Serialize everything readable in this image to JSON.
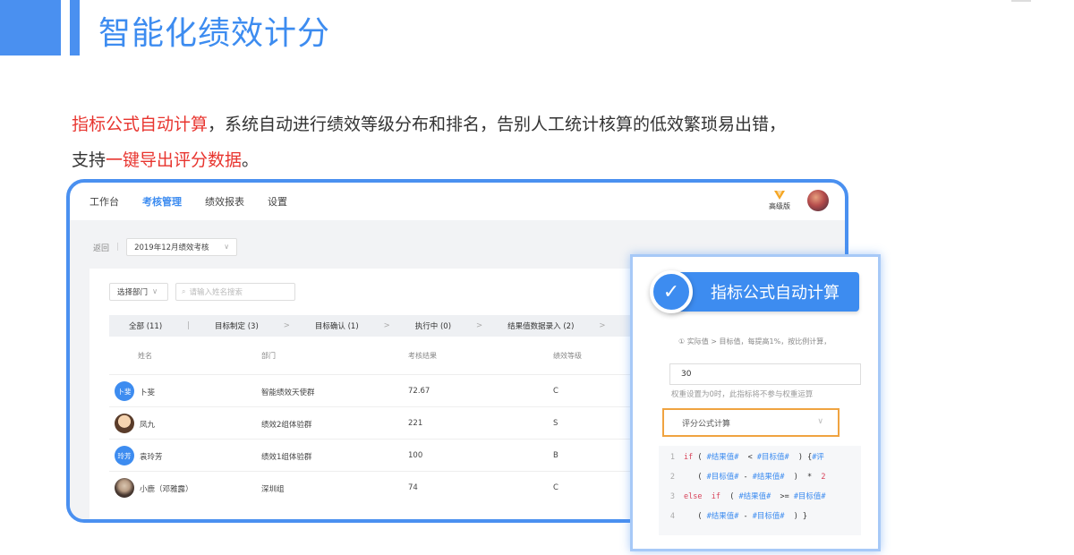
{
  "slide": {
    "title": "智能化绩效计分",
    "desc_line1_highlight": "指标公式自动计算",
    "desc_line1_rest": "，系统自动进行绩效等级分布和排名，告别人工统计核算的低效繁琐易出错，",
    "desc_line2_prefix": "支持",
    "desc_line2_highlight": "一键导出评分数据",
    "desc_line2_suffix": "。"
  },
  "nav": {
    "items": [
      "工作台",
      "考核管理",
      "绩效报表",
      "设置"
    ],
    "vip_label": "高级版"
  },
  "toolbar": {
    "back_label": "返回",
    "separator": "|",
    "period": "2019年12月绩效考核"
  },
  "filters": {
    "dept_label": "选择部门",
    "search_placeholder": "请输入姓名搜索"
  },
  "tabs": [
    "全部 (11)",
    "目标制定 (3)",
    "目标确认 (1)",
    "执行中 (0)",
    "结果值数据录入 (2)"
  ],
  "tab_separators": [
    "|",
    ">",
    ">",
    ">",
    ">"
  ],
  "table": {
    "headers": [
      "姓名",
      "部门",
      "考核结果",
      "绩效等级"
    ],
    "rows": [
      {
        "avatar_text": "卜斐",
        "name": "卜斐",
        "dept": "智能绩效天使群",
        "score": "72.67",
        "grade": "C"
      },
      {
        "avatar_text": "",
        "name": "凤九",
        "dept": "绩效2组体验群",
        "score": "221",
        "grade": "S"
      },
      {
        "avatar_text": "玲芳",
        "name": "袁玲芳",
        "dept": "绩效1组体验群",
        "score": "100",
        "grade": "B"
      },
      {
        "avatar_text": "",
        "name": "小鹿（邓雅露）",
        "dept": "深圳组",
        "score": "74",
        "grade": "C"
      }
    ]
  },
  "popup": {
    "banner": "指标公式自动计算",
    "clipped_text": "① 实际值 > 目标值，每提高1%，按比例计算，",
    "weight_value": "30",
    "hint": "权重设置为0时，此指标将不参与权重运算",
    "formula_select": "评分公式计算",
    "code_lines": [
      {
        "num": "1",
        "tokens": [
          [
            "kw",
            "if"
          ],
          [
            "op",
            " ( "
          ],
          [
            "var",
            "#结果值#"
          ],
          [
            "op",
            "  < "
          ],
          [
            "var",
            "#目标值#"
          ],
          [
            "op",
            "  ) {"
          ],
          [
            "var",
            "#评"
          ]
        ]
      },
      {
        "num": "2",
        "tokens": [
          [
            "op",
            "   ( "
          ],
          [
            "var",
            "#目标值#"
          ],
          [
            "op",
            " - "
          ],
          [
            "var",
            "#结果值#"
          ],
          [
            "op",
            "  )  *  "
          ],
          [
            "num",
            "2"
          ]
        ]
      },
      {
        "num": "3",
        "tokens": [
          [
            "kw",
            "else"
          ],
          [
            "op",
            "  "
          ],
          [
            "kw",
            "if"
          ],
          [
            "op",
            "  ( "
          ],
          [
            "var",
            "#结果值#"
          ],
          [
            "op",
            "  >= "
          ],
          [
            "var",
            "#目标值#"
          ]
        ]
      },
      {
        "num": "4",
        "tokens": [
          [
            "op",
            "   ( "
          ],
          [
            "var",
            "#结果值#"
          ],
          [
            "op",
            " - "
          ],
          [
            "var",
            "#目标值#"
          ],
          [
            "op",
            "  ) }"
          ]
        ]
      }
    ]
  },
  "colors": {
    "accent": "#3d8cf0",
    "highlight": "#e8352f",
    "orange_border": "#f0a340"
  }
}
